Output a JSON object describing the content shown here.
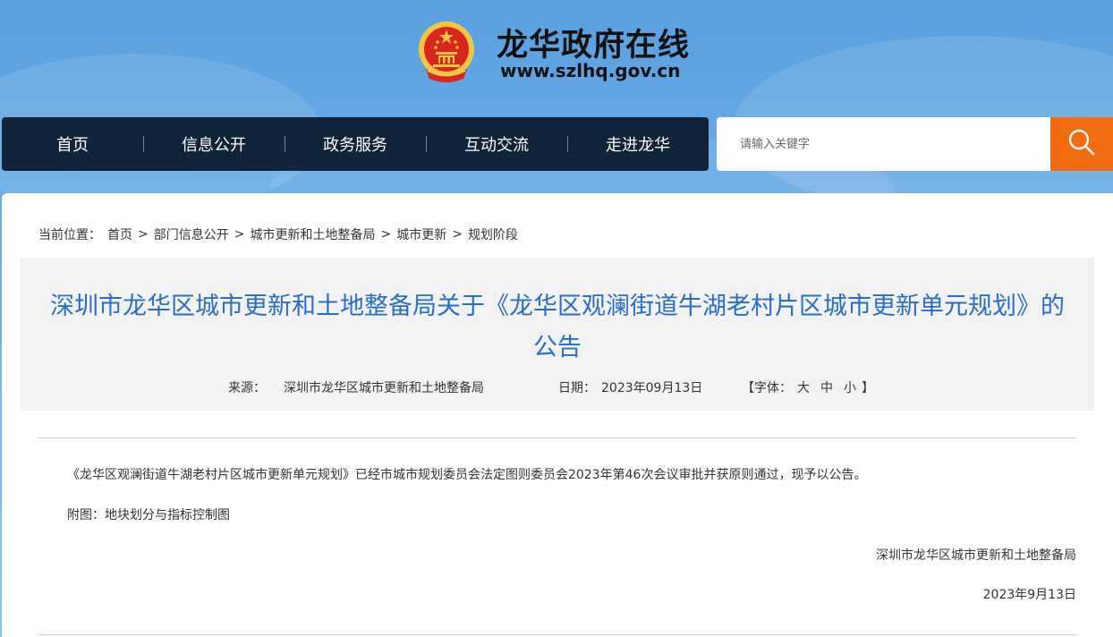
{
  "site": {
    "name": "龙华政府在线",
    "url": "www.szlhq.gov.cn"
  },
  "nav": {
    "items": [
      "首页",
      "信息公开",
      "政务服务",
      "互动交流",
      "走进龙华"
    ]
  },
  "search": {
    "placeholder": "请输入关键字",
    "icon": "search-icon"
  },
  "breadcrumb": {
    "label": "当前位置：",
    "items": [
      "首页",
      "部门信息公开",
      "城市更新和土地整备局",
      "城市更新",
      "规划阶段"
    ],
    "separator": ">"
  },
  "article": {
    "title": "深圳市龙华区城市更新和土地整备局关于《龙华区观澜街道牛湖老村片区城市更新单元规划》的公告",
    "source_label": "来源：",
    "source": "深圳市龙华区城市更新和土地整备局",
    "date_label": "日期：",
    "date": "2023年09月13日",
    "font_size_open": "【字体：",
    "font_sizes": [
      "大",
      "中",
      "小"
    ],
    "font_size_close": "】",
    "body": "《龙华区观澜街道牛湖老村片区城市更新单元规划》已经市城市规划委员会法定图则委员会2023年第46次会议审批并获原则通过，现予以公告。",
    "attachment": "附图：地块划分与指标控制图",
    "signature": "深圳市龙华区城市更新和土地整备局",
    "signature_date": "2023年9月13日"
  },
  "colors": {
    "nav_bg": "#10243a",
    "search_btn": "#f26b10",
    "title": "#2a6dc7",
    "emblem_red": "#d9251d",
    "emblem_gold": "#f4c542"
  }
}
